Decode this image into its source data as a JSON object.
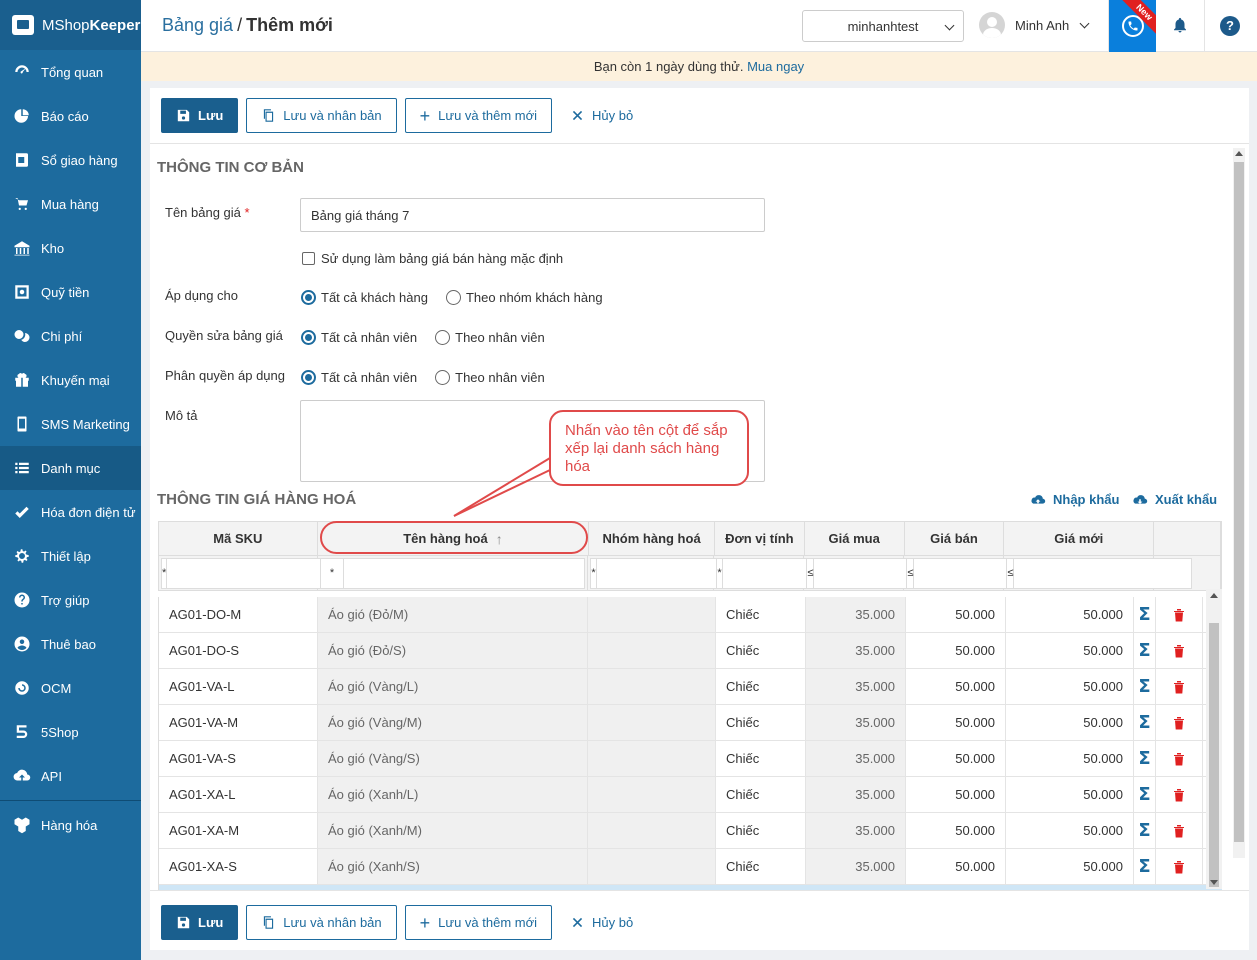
{
  "app": {
    "logo_prefix": "MShop",
    "logo_suffix": "Keeper"
  },
  "sidebar": {
    "items": [
      {
        "label": "Tổng quan",
        "icon": "dashboard-icon"
      },
      {
        "label": "Báo cáo",
        "icon": "pie-chart-icon"
      },
      {
        "label": "Sổ giao hàng",
        "icon": "delivery-book-icon"
      },
      {
        "label": "Mua hàng",
        "icon": "cart-icon"
      },
      {
        "label": "Kho",
        "icon": "warehouse-icon"
      },
      {
        "label": "Quỹ tiền",
        "icon": "safe-icon"
      },
      {
        "label": "Chi phí",
        "icon": "coins-icon"
      },
      {
        "label": "Khuyến mại",
        "icon": "gift-icon"
      },
      {
        "label": "SMS Marketing",
        "icon": "phone-icon"
      },
      {
        "label": "Danh mục",
        "icon": "list-icon"
      },
      {
        "label": "Hóa đơn điện tử",
        "icon": "invoice-icon"
      },
      {
        "label": "Thiết lập",
        "icon": "gear-icon"
      },
      {
        "label": "Trợ giúp",
        "icon": "question-icon"
      },
      {
        "label": "Thuê bao",
        "icon": "user-icon"
      },
      {
        "label": "OCM",
        "icon": "ocm-icon"
      },
      {
        "label": "5Shop",
        "icon": "fiveshop-icon"
      },
      {
        "label": "API",
        "icon": "cloud-upload-icon"
      },
      {
        "label": "Hàng hóa",
        "icon": "boxes-icon"
      }
    ],
    "active": "Danh mục"
  },
  "header": {
    "breadcrumb_parent": "Bảng giá",
    "breadcrumb_sep": "/",
    "breadcrumb_current": "Thêm mới",
    "store": "minhanhtest",
    "user_name": "Minh Anh",
    "new_badge": "New",
    "help": "?"
  },
  "trial": {
    "text": "Bạn còn 1 ngày dùng thử.",
    "link": "Mua ngay"
  },
  "toolbar": {
    "save": "Lưu",
    "save_duplicate": "Lưu và nhân bản",
    "save_new": "Lưu và thêm mới",
    "cancel": "Hủy bỏ"
  },
  "basic_info": {
    "title": "THÔNG TIN CƠ BẢN",
    "name_label": "Tên bảng giá",
    "required_mark": "*",
    "name_value": "Bảng giá tháng 7",
    "default_checkbox": "Sử dụng làm bảng giá bán hàng mặc định",
    "apply_label": "Áp dụng cho",
    "apply_options": [
      "Tất cả khách hàng",
      "Theo nhóm khách hàng"
    ],
    "edit_label": "Quyền sửa bảng giá",
    "edit_options": [
      "Tất cả nhân viên",
      "Theo nhân viên"
    ],
    "apply_perm_label": "Phân quyền áp dụng",
    "apply_perm_options": [
      "Tất cả nhân viên",
      "Theo nhân viên"
    ],
    "desc_label": "Mô tả",
    "desc_value": ""
  },
  "price_info": {
    "title": "THÔNG TIN GIÁ HÀNG HOÁ",
    "import": "Nhập khẩu",
    "export": "Xuất khẩu"
  },
  "table": {
    "columns": [
      "Mã SKU",
      "Tên hàng hoá",
      "Nhóm hàng hoá",
      "Đơn vị tính",
      "Giá mua",
      "Giá bán",
      "Giá mới"
    ],
    "sort_arrow": "↑",
    "filter_ops": [
      "*",
      "*",
      "*",
      "*",
      "≤",
      "≤",
      "≤"
    ],
    "rows": [
      {
        "sku": "AG01-DO-M",
        "name": "Áo gió (Đỏ/M)",
        "group": "",
        "unit": "Chiếc",
        "buy": "35.000",
        "sell": "50.000",
        "new": "50.000"
      },
      {
        "sku": "AG01-DO-S",
        "name": "Áo gió (Đỏ/S)",
        "group": "",
        "unit": "Chiếc",
        "buy": "35.000",
        "sell": "50.000",
        "new": "50.000"
      },
      {
        "sku": "AG01-VA-L",
        "name": "Áo gió (Vàng/L)",
        "group": "",
        "unit": "Chiếc",
        "buy": "35.000",
        "sell": "50.000",
        "new": "50.000"
      },
      {
        "sku": "AG01-VA-M",
        "name": "Áo gió (Vàng/M)",
        "group": "",
        "unit": "Chiếc",
        "buy": "35.000",
        "sell": "50.000",
        "new": "50.000"
      },
      {
        "sku": "AG01-VA-S",
        "name": "Áo gió (Vàng/S)",
        "group": "",
        "unit": "Chiếc",
        "buy": "35.000",
        "sell": "50.000",
        "new": "50.000"
      },
      {
        "sku": "AG01-XA-L",
        "name": "Áo gió (Xanh/L)",
        "group": "",
        "unit": "Chiếc",
        "buy": "35.000",
        "sell": "50.000",
        "new": "50.000"
      },
      {
        "sku": "AG01-XA-M",
        "name": "Áo gió (Xanh/M)",
        "group": "",
        "unit": "Chiếc",
        "buy": "35.000",
        "sell": "50.000",
        "new": "50.000"
      },
      {
        "sku": "AG01-XA-S",
        "name": "Áo gió (Xanh/S)",
        "group": "",
        "unit": "Chiếc",
        "buy": "35.000",
        "sell": "50.000",
        "new": "50.000"
      }
    ]
  },
  "callout": {
    "text": "Nhấn vào tên cột để sắp xếp lại danh sách hàng hóa"
  }
}
